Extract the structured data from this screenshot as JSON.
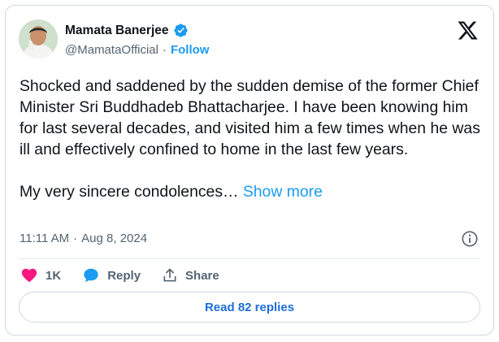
{
  "author": {
    "name": "Mamata Banerjee",
    "handle": "@MamataOfficial",
    "separator": "·",
    "follow_label": "Follow",
    "verified_icon": "verified-badge-icon"
  },
  "tweet": {
    "text": "Shocked and saddened by the sudden demise of the former Chief Minister Sri Buddhadeb Bhattacharjee. I have been knowing him for last several decades, and visited him a few times when he was ill and effectively confined to home in the last few years.\n\nMy very sincere condolences…",
    "show_more": "Show more",
    "time": "11:11 AM",
    "date": "Aug 8, 2024",
    "separator": "·"
  },
  "actions": {
    "likes": "1K",
    "reply_label": "Reply",
    "share_label": "Share"
  },
  "replies_button": "Read 82 replies",
  "colors": {
    "accent": "#1d9bf0",
    "like": "#f91880",
    "verified": "#1d9bf0",
    "text": "#0f1419",
    "muted": "#536471"
  }
}
